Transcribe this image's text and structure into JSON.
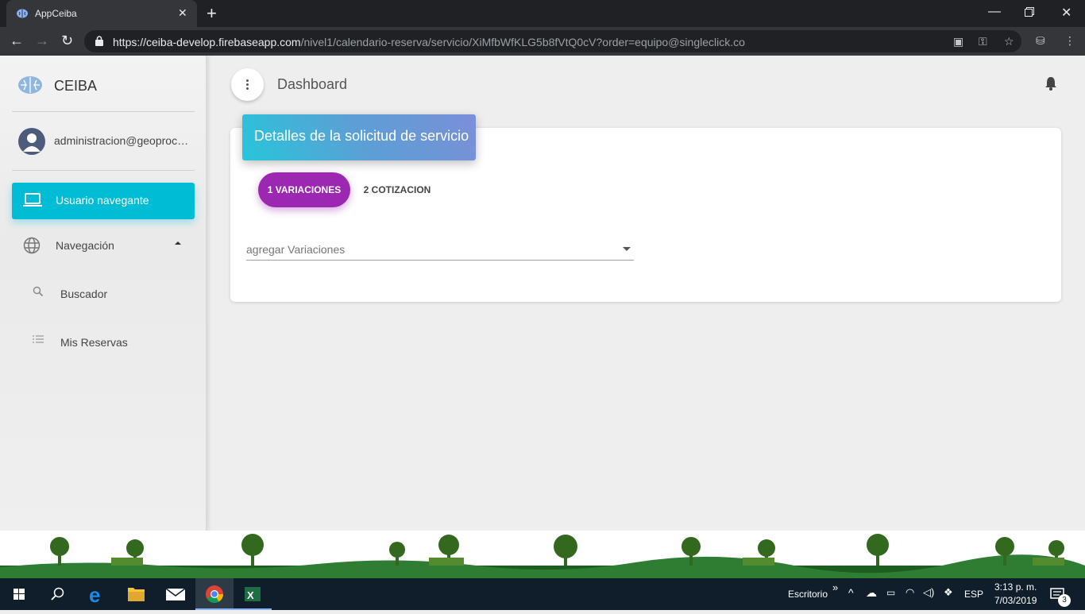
{
  "browser": {
    "tab_title": "AppCeiba",
    "url_host": "https://ceiba-develop.firebaseapp.com",
    "url_path": "/nivel1/calendario-reserva/servicio/XiMfbWfKLG5b8fVtQ0cV?order=equipo@singleclick.co",
    "icons": [
      "brain-icon",
      "close-icon",
      "plus-icon",
      "minimize-icon",
      "restore-icon",
      "window-close-icon",
      "back-icon",
      "forward-icon",
      "reload-icon",
      "lock-icon",
      "translate-icon",
      "key-icon",
      "star-icon",
      "extension-icon",
      "more-icon"
    ]
  },
  "sidebar": {
    "brand": "CEIBA",
    "user": "administracion@geoprocesos.com.co",
    "items": [
      {
        "label": "Usuario navegante",
        "icon": "laptop-icon",
        "active": true
      },
      {
        "label": "Navegación",
        "icon": "globe-icon",
        "expanded": true
      },
      {
        "label": "Buscador",
        "icon": "search-icon"
      },
      {
        "label": "Mis Reservas",
        "icon": "list-icon"
      }
    ]
  },
  "header": {
    "title": "Dashboard",
    "bell_icon": "bell-icon"
  },
  "card": {
    "title": "Detalles de la solicitud de servicio",
    "steps": [
      {
        "label": "1 VARIACIONES",
        "active": true
      },
      {
        "label": "2 COTIZACION",
        "active": false
      }
    ],
    "select_placeholder": "agregar Variaciones"
  },
  "taskbar": {
    "desktop_label": "Escritorio",
    "language": "ESP",
    "time": "3:13 p. m.",
    "date": "7/03/2019",
    "notification_count": "3"
  },
  "colors": {
    "accent_cyan": "#00bcd4",
    "step_purple": "#9c27b0",
    "header_gradient_start": "#26c6da",
    "header_gradient_end": "#7b8fd8"
  }
}
